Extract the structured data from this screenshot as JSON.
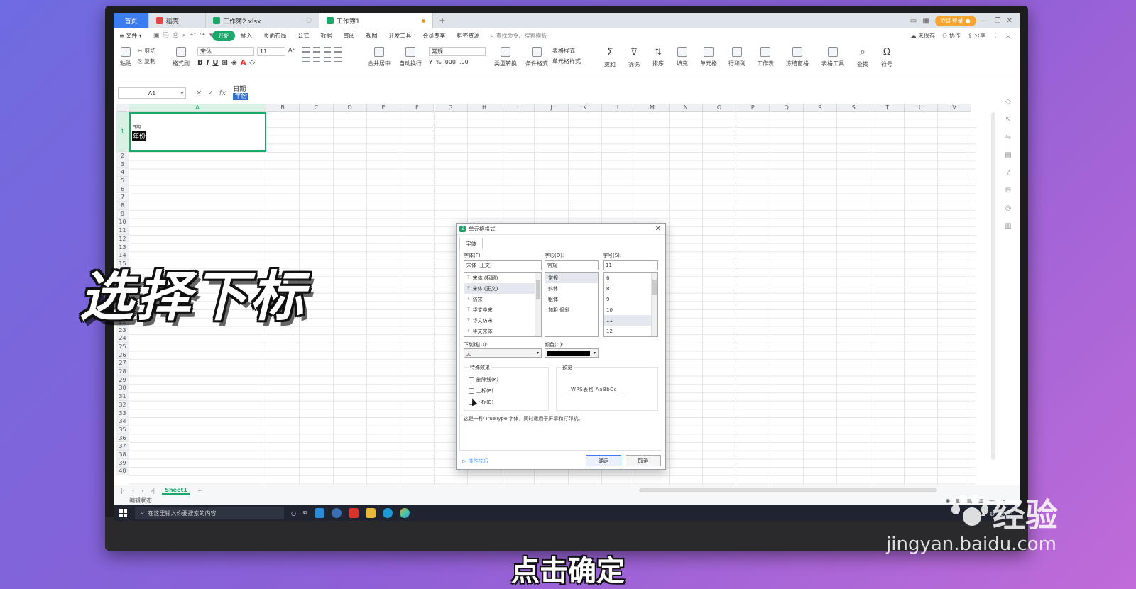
{
  "tabs": {
    "home": "首页",
    "tab1": "稻壳",
    "tab2": "工作簿2.xlsx",
    "tab3": "工作簿1",
    "login": "立即登录"
  },
  "menu": {
    "file": "文件",
    "items": [
      "开始",
      "插入",
      "页面布局",
      "公式",
      "数据",
      "审阅",
      "视图",
      "开发工具",
      "会员专享",
      "稻壳资源"
    ],
    "search": "查找命令、搜索模板",
    "unsaved": "未保存",
    "collab": "协作",
    "share": "分享"
  },
  "ribbon": {
    "paste": "粘贴",
    "cut": "剪切",
    "copy": "复制",
    "format_painter": "格式刷",
    "font_name": "宋体",
    "font_size": "11",
    "merge": "合并居中",
    "wrap": "自动换行",
    "number_format": "常规",
    "type_convert": "类型转换",
    "cond_format": "条件格式",
    "table_style": "表格样式",
    "cell_style": "单元格样式",
    "sum": "求和",
    "filter": "筛选",
    "sort": "排序",
    "fill": "填充",
    "cell": "单元格",
    "row_col": "行和列",
    "worksheet": "工作表",
    "freeze": "冻结窗格",
    "table_tools": "表格工具",
    "find": "查找",
    "symbol": "符号"
  },
  "formula_bar": {
    "name_box": "A1",
    "line1": "日期",
    "line2": "年份"
  },
  "grid": {
    "columns": [
      "A",
      "B",
      "C",
      "D",
      "E",
      "F",
      "G",
      "H",
      "I",
      "J",
      "K",
      "L",
      "M",
      "N",
      "O",
      "P",
      "Q",
      "R",
      "S",
      "T",
      "U",
      "V"
    ],
    "rows": [
      "1",
      "2",
      "3",
      "4",
      "5",
      "6",
      "7",
      "8",
      "9",
      "10",
      "11",
      "12",
      "13",
      "14",
      "15",
      "16",
      "17",
      "18",
      "19",
      "20",
      "21",
      "22",
      "23",
      "24",
      "25",
      "26",
      "27",
      "28",
      "29",
      "30",
      "31",
      "32",
      "33",
      "34",
      "35",
      "36",
      "37",
      "38",
      "39",
      "40"
    ],
    "a1_small": "日期",
    "a1_big": "年份"
  },
  "sheet": {
    "name": "Sheet1",
    "status": "编辑状态"
  },
  "taskbar": {
    "search": "在这里输入你要搜索的内容"
  },
  "dialog": {
    "title": "单元格格式",
    "tab": "字体",
    "font_label": "字体(F):",
    "font_value": "宋体 (正文)",
    "font_list": [
      "宋体 (标题)",
      "宋体 (正文)",
      "仿宋",
      "华文中宋",
      "华文仿宋",
      "华文宋体"
    ],
    "style_label": "字形(O):",
    "style_value": "常规",
    "style_list": [
      "常规",
      "斜体",
      "粗体",
      "加粗 倾斜"
    ],
    "size_label": "字号(S):",
    "size_value": "11",
    "size_list": [
      "6",
      "8",
      "9",
      "10",
      "11",
      "12"
    ],
    "underline_label": "下划线(U):",
    "underline_value": "无",
    "color_label": "颜色(C):",
    "effects_label": "特殊效果",
    "strike": "删除线(K)",
    "superscript": "上标(E)",
    "subscript": "下标(B)",
    "preview_label": "预览",
    "preview_text": "____WPS表格  AaBbCc____",
    "note": "这是一种 TrueType 字体，同时适用于屏幕和打印机。",
    "tips": "操作技巧",
    "ok": "确定",
    "cancel": "取消"
  },
  "overlay": {
    "caption": "选择下标",
    "subtitle": "点击确定",
    "wm_text": "经验",
    "wm_url": "jingyan.baidu.com"
  }
}
